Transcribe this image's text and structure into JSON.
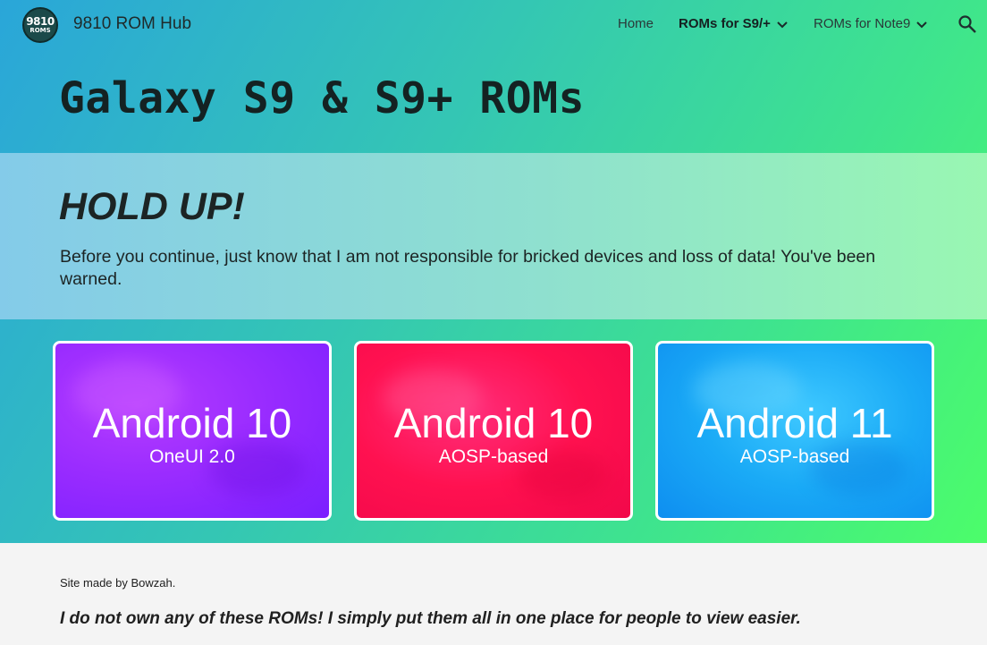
{
  "header": {
    "logo_text_top": "9810",
    "logo_text_bottom": "ROMS",
    "site_title": "9810 ROM Hub",
    "nav": [
      {
        "label": "Home"
      },
      {
        "label": "ROMs for S9/+"
      },
      {
        "label": "ROMs for Note9"
      }
    ],
    "active_nav": "ROMs for S9/+"
  },
  "page_title": "Galaxy S9 & S9+ ROMs",
  "warning": {
    "heading": "HOLD UP!",
    "text": "Before you continue, just know that I am not responsible for bricked devices and loss of data! You've been warned."
  },
  "cards": [
    {
      "title": "Android 10",
      "subtitle": "OneUI 2.0",
      "color": "#9a2cff"
    },
    {
      "title": "Android 10",
      "subtitle": "AOSP-based",
      "color": "#ff1150"
    },
    {
      "title": "Android 11",
      "subtitle": "AOSP-based",
      "color": "#1aaaf6"
    }
  ],
  "footer": {
    "credit": "Site made by Bowzah.",
    "disclaimer": "I do not own any of these ROMs! I simply put them all in one place for people to view easier."
  },
  "icons": {
    "logo": "9810-roms-logo",
    "nav_dropdown": "chevron-down-icon",
    "search": "search-icon"
  }
}
